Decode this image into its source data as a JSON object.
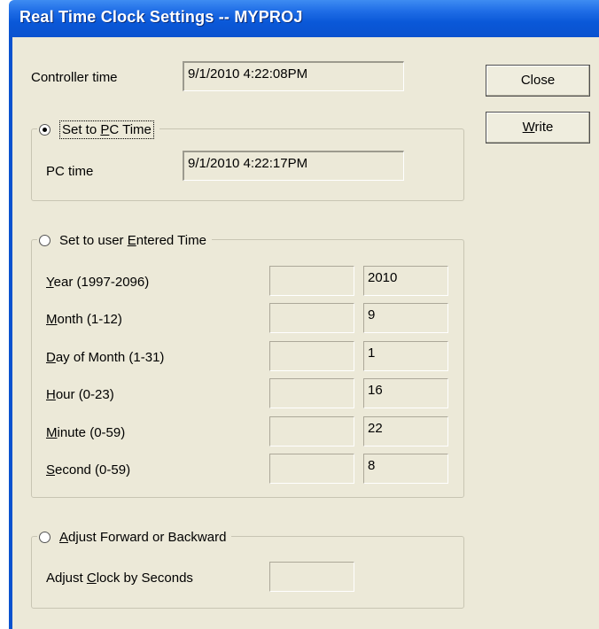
{
  "window": {
    "title": "Real Time Clock Settings -- MYPROJ"
  },
  "controller": {
    "label": "Controller time",
    "value": "9/1/2010 4:22:08PM"
  },
  "buttons": {
    "close": "Close",
    "write_pre": "",
    "write_key": "W",
    "write_post": "rite"
  },
  "pc_group": {
    "radio_pre": "Set to ",
    "radio_key": "P",
    "radio_post": "C Time",
    "pc_label": "PC time",
    "pc_value": "9/1/2010 4:22:17PM"
  },
  "user_group": {
    "radio_pre": "Set to user ",
    "radio_key": "E",
    "radio_post": "ntered Time",
    "rows": [
      {
        "pre": "",
        "key": "Y",
        "post": "ear (1997-2096)",
        "input": "",
        "current": "2010"
      },
      {
        "pre": "",
        "key": "M",
        "post": "onth (1-12)",
        "input": "",
        "current": "9"
      },
      {
        "pre": "",
        "key": "D",
        "post": "ay of Month (1-31)",
        "input": "",
        "current": "1"
      },
      {
        "pre": "",
        "key": "H",
        "post": "our (0-23)",
        "input": "",
        "current": "16"
      },
      {
        "pre": "",
        "key": "M",
        "post": "inute (0-59)",
        "input": "",
        "current": "22"
      },
      {
        "pre": "",
        "key": "S",
        "post": "econd (0-59)",
        "input": "",
        "current": "8"
      }
    ]
  },
  "adjust_group": {
    "radio_pre": "",
    "radio_key": "A",
    "radio_post": "djust Forward or Backward",
    "label_pre": "Adjust ",
    "label_key": "C",
    "label_post": "lock by Seconds",
    "input": ""
  }
}
